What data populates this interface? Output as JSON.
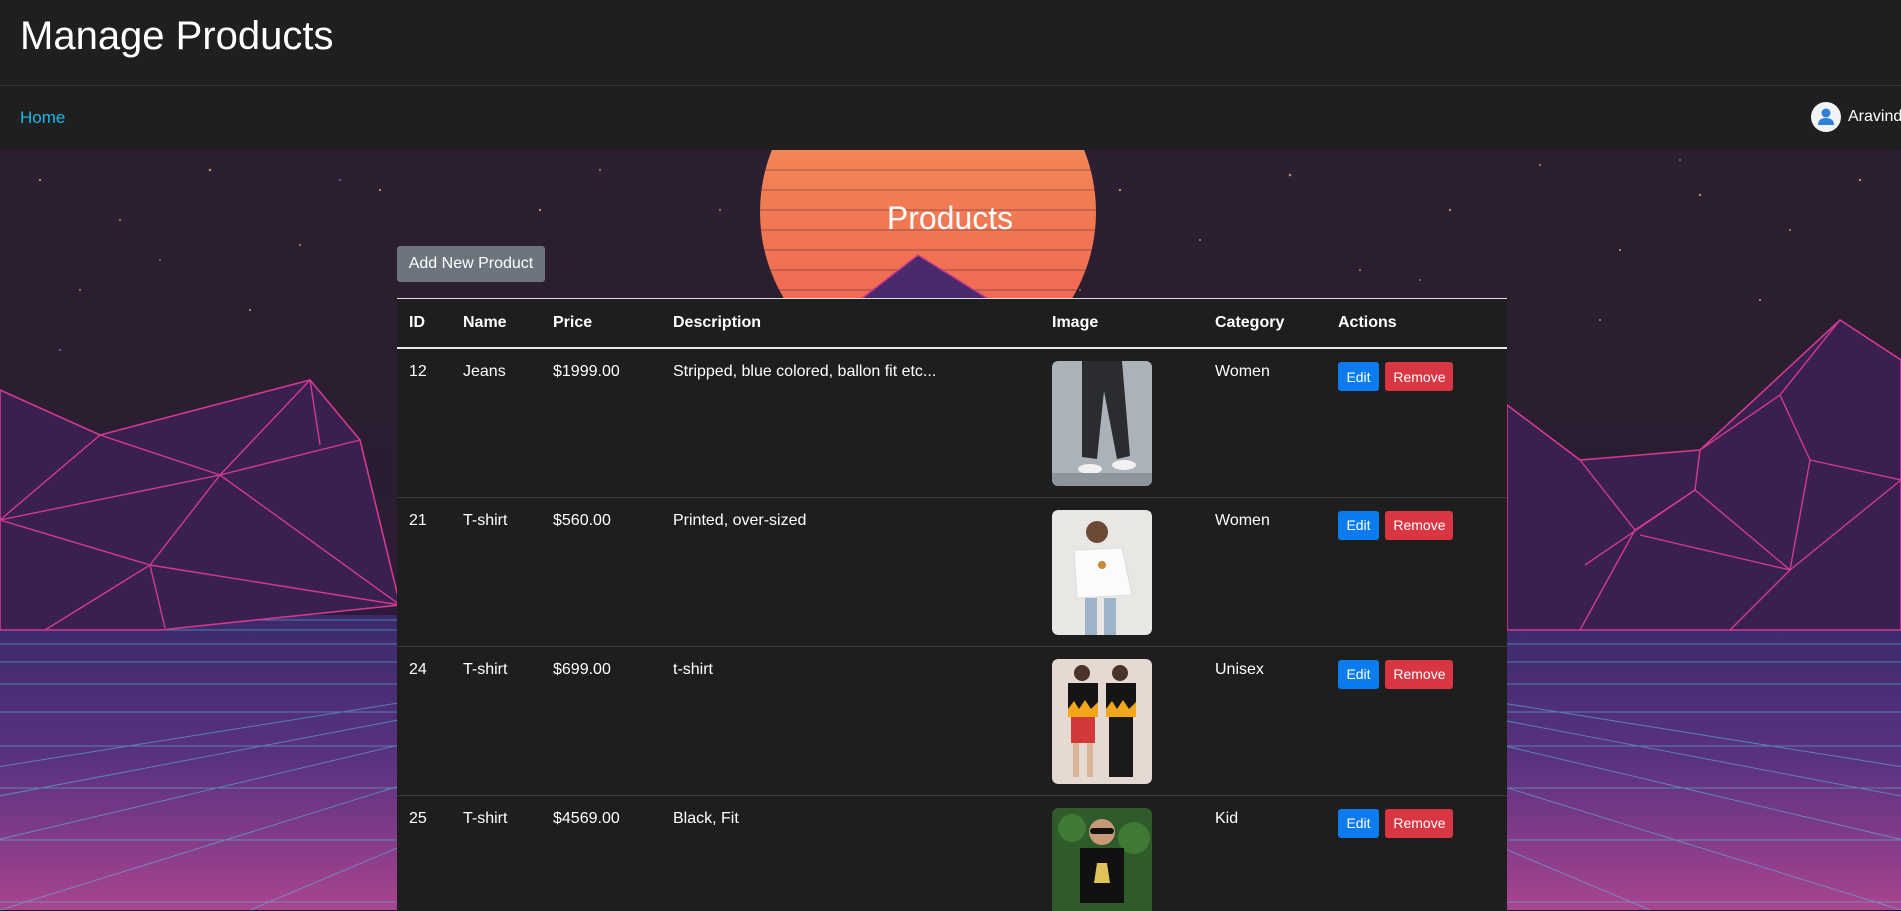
{
  "header": {
    "title": "Manage Products"
  },
  "nav": {
    "home_label": "Home",
    "user_name": "Aravind"
  },
  "page": {
    "heading": "Products",
    "add_button": "Add New Product"
  },
  "table": {
    "columns": [
      "ID",
      "Name",
      "Price",
      "Description",
      "Image",
      "Category",
      "Actions"
    ],
    "rows": [
      {
        "id": "12",
        "name": "Jeans",
        "price": "$1999.00",
        "description": "Stripped, blue colored, ballon fit etc...",
        "image": "product-photo-jeans",
        "category": "Women",
        "edit": "Edit",
        "remove": "Remove"
      },
      {
        "id": "21",
        "name": "T-shirt",
        "price": "$560.00",
        "description": "Printed, over-sized",
        "image": "product-photo-white-tshirt",
        "category": "Women",
        "edit": "Edit",
        "remove": "Remove"
      },
      {
        "id": "24",
        "name": "T-shirt",
        "price": "$699.00",
        "description": "t-shirt",
        "image": "product-photo-flame-tshirts",
        "category": "Unisex",
        "edit": "Edit",
        "remove": "Remove"
      },
      {
        "id": "25",
        "name": "T-shirt",
        "price": "$4569.00",
        "description": "Black, Fit",
        "image": "product-photo-kid-tshirt",
        "category": "Kid",
        "edit": "Edit",
        "remove": "Remove"
      }
    ]
  },
  "colors": {
    "link": "#18b7e8",
    "edit_button": "#0a7cf0",
    "remove_button": "#d93643",
    "add_button": "#6c757d",
    "surface": "#1e1e1e"
  }
}
